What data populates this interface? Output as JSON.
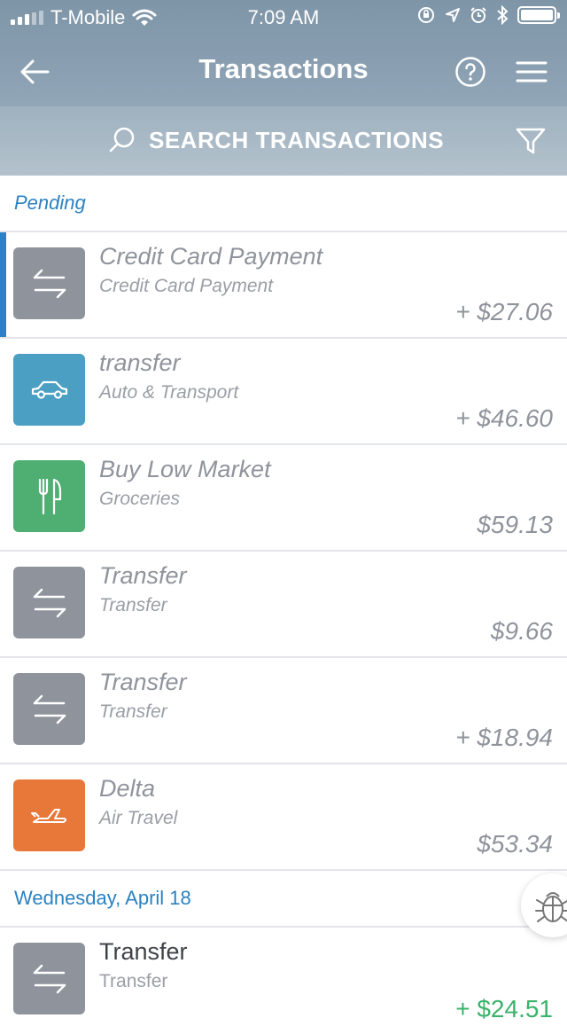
{
  "status_bar": {
    "carrier": "T-Mobile",
    "time": "7:09 AM",
    "signal_bars_filled": 3,
    "signal_bars_total": 5,
    "battery_level": 1.0,
    "icons": [
      "wifi-icon",
      "orientation-lock-icon",
      "location-icon",
      "alarm-icon",
      "bluetooth-icon",
      "battery-icon"
    ]
  },
  "nav": {
    "title": "Transactions",
    "back_icon": "back-arrow-icon",
    "help_icon": "help-icon",
    "menu_icon": "hamburger-menu-icon"
  },
  "search": {
    "label": "SEARCH TRANSACTIONS",
    "search_icon": "search-icon",
    "filter_icon": "filter-icon"
  },
  "sections": [
    {
      "header": "Pending",
      "transactions": [
        {
          "name": "Credit Card Payment",
          "category": "Credit Card Payment",
          "amount": "+ $27.06",
          "icon": "transfer-icon",
          "color": "#8e939c",
          "selected": true
        },
        {
          "name": "transfer",
          "category": "Auto & Transport",
          "amount": "+ $46.60",
          "icon": "car-icon",
          "color": "#4a9fc3"
        },
        {
          "name": "Buy Low Market",
          "category": "Groceries",
          "amount": "$59.13",
          "icon": "fork-knife-icon",
          "color": "#4fae72"
        },
        {
          "name": "Transfer",
          "category": "Transfer",
          "amount": "$9.66",
          "icon": "transfer-icon",
          "color": "#8e939c"
        },
        {
          "name": "Transfer",
          "category": "Transfer",
          "amount": "+ $18.94",
          "icon": "transfer-icon",
          "color": "#8e939c"
        },
        {
          "name": "Delta",
          "category": "Air Travel",
          "amount": "$53.34",
          "icon": "airplane-icon",
          "color": "#e8773a"
        }
      ]
    },
    {
      "header": "Wednesday, April 18",
      "transactions": [
        {
          "name": "Transfer",
          "category": "Transfer",
          "amount": "+ $24.51",
          "icon": "transfer-icon",
          "color": "#8e939c"
        }
      ]
    }
  ],
  "bug_report_icon": "bug-icon",
  "colors": {
    "accent_blue": "#2b82c2",
    "positive_green": "#39b36a",
    "header_gradient_top": "#7e95a8",
    "header_gradient_bottom": "#a9bac6"
  }
}
